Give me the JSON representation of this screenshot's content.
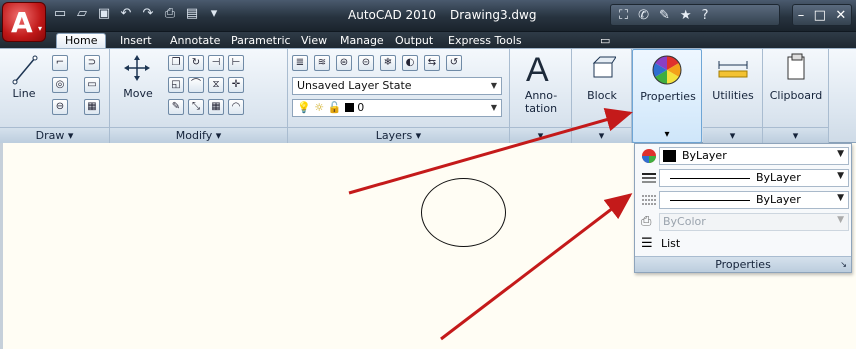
{
  "titlebar": {
    "app_letter": "A",
    "app_name": "AutoCAD 2010",
    "document": "Drawing3.dwg"
  },
  "tabs": [
    {
      "label": "Home"
    },
    {
      "label": "Insert"
    },
    {
      "label": "Annotate"
    },
    {
      "label": "Parametric"
    },
    {
      "label": "View"
    },
    {
      "label": "Manage"
    },
    {
      "label": "Output"
    },
    {
      "label": "Express Tools"
    }
  ],
  "ribbon": {
    "draw": {
      "line_label": "Line",
      "footer": "Draw ▾"
    },
    "modify": {
      "move_label": "Move",
      "footer": "Modify ▾"
    },
    "layers": {
      "state_dropdown": "Unsaved Layer State",
      "layer_dropdown": "0",
      "footer": "Layers ▾"
    },
    "annotation": {
      "label1": "Anno-",
      "label2": "tation",
      "big_glyph": "A"
    },
    "block": {
      "label": "Block"
    },
    "properties": {
      "label": "Properties"
    },
    "utilities": {
      "label": "Utilities"
    },
    "clipboard": {
      "label": "Clipboard"
    }
  },
  "properties_panel": {
    "color": "ByLayer",
    "linetype": "ByLayer",
    "lineweight": "ByLayer",
    "plotstyle": "ByColor",
    "list_label": "List",
    "footer": "Properties"
  },
  "colors": {
    "arrow": "#c41a1a",
    "app_button": "#c01818",
    "canvas": "#fffdf4"
  }
}
